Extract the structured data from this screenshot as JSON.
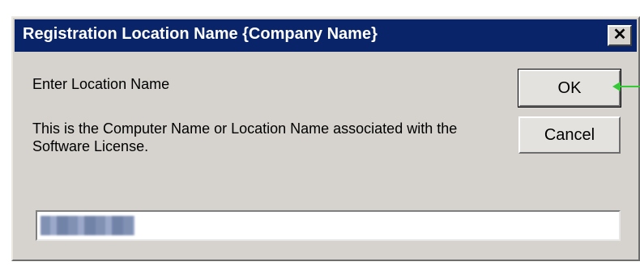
{
  "dialog": {
    "title": "Registration Location Name {Company Name}",
    "close_glyph": "✕",
    "prompt": "Enter Location Name",
    "description": "This is the Computer Name or Location Name associated with the Software License.",
    "ok_label": "OK",
    "cancel_label": "Cancel",
    "location_field": {
      "value_redacted": true,
      "placeholder": ""
    },
    "annotation_arrow_color": "#37c837",
    "titlebar_color": "#0a246a"
  }
}
